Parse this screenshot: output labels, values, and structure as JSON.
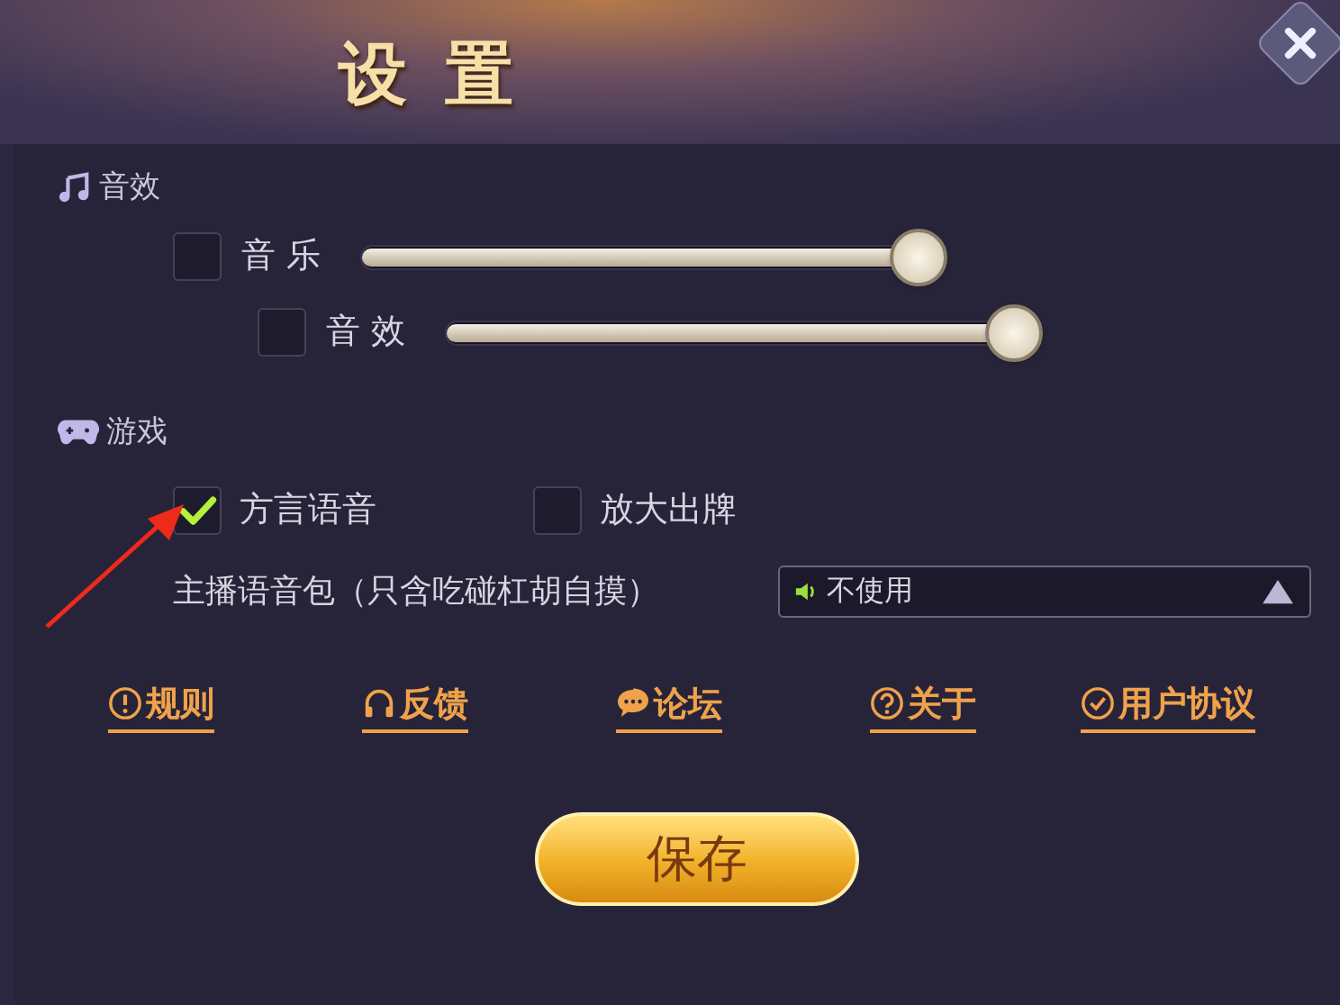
{
  "title": "设 置",
  "sound": {
    "title": "音效",
    "sliders": [
      {
        "label": "音 乐",
        "checked": false,
        "level": 0.98
      },
      {
        "label": "音 效",
        "checked": false,
        "level": 1
      }
    ]
  },
  "game": {
    "title": "游戏",
    "options": [
      {
        "label": "方言语音",
        "checked": true
      },
      {
        "label": "放大出牌",
        "checked": false
      }
    ],
    "voice_pack": {
      "label": "主播语音包（只含吃碰杠胡自摸）",
      "value": "不使用"
    }
  },
  "links": [
    {
      "kind": "info",
      "label": "规则"
    },
    {
      "kind": "headset",
      "label": "反馈"
    },
    {
      "kind": "chat",
      "label": "论坛"
    },
    {
      "kind": "help",
      "label": "关于"
    },
    {
      "kind": "check",
      "label": "用户协议"
    }
  ],
  "save_button": "保存"
}
